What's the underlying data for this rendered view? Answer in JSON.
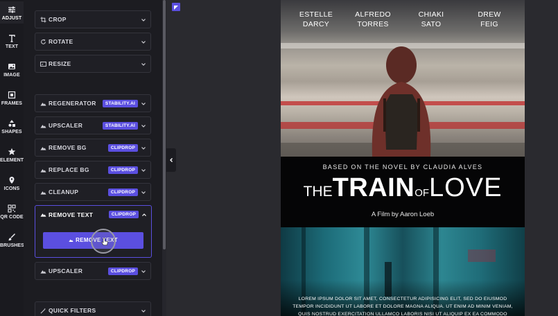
{
  "rail": {
    "items": [
      {
        "label": "ADJUST",
        "icon": "sliders-icon"
      },
      {
        "label": "TEXT",
        "icon": "text-icon"
      },
      {
        "label": "IMAGE",
        "icon": "image-icon"
      },
      {
        "label": "FRAMES",
        "icon": "frames-icon"
      },
      {
        "label": "SHAPES",
        "icon": "shapes-icon"
      },
      {
        "label": "ELEMENTS",
        "icon": "star-icon"
      },
      {
        "label": "ICONS",
        "icon": "pin-icon"
      },
      {
        "label": "QR CODE",
        "icon": "qr-icon"
      },
      {
        "label": "BRUSHES",
        "icon": "brush-icon"
      }
    ]
  },
  "panel": {
    "tools": [
      {
        "label": "CROP",
        "icon": "crop-icon"
      },
      {
        "label": "ROTATE",
        "icon": "rotate-icon"
      },
      {
        "label": "RESIZE",
        "icon": "resize-icon"
      }
    ],
    "ai_tools": [
      {
        "label": "REGENERATOR",
        "badge": "STABILITY.AI"
      },
      {
        "label": "UPSCALER",
        "badge": "STABILITY.AI"
      },
      {
        "label": "REMOVE BG",
        "badge": "CLIPDROP"
      },
      {
        "label": "REPLACE BG",
        "badge": "CLIPDROP"
      },
      {
        "label": "CLEANUP",
        "badge": "CLIPDROP"
      }
    ],
    "expanded": {
      "label": "REMOVE TEXT",
      "badge": "CLIPDROP",
      "button": "REMOVE TEXT"
    },
    "after": [
      {
        "label": "UPSCALER",
        "badge": "CLIPDROP"
      }
    ],
    "quick_filters": {
      "label": "QUICK FILTERS"
    }
  },
  "poster": {
    "names": [
      "ESTELLE",
      "DARCY",
      "ALFREDO",
      "TORRES",
      "CHIAKI",
      "SATO",
      "DREW",
      "FEIG"
    ],
    "subtitle": "BASED ON THE NOVEL BY CLAUDIA ALVES",
    "title": {
      "the": "THE",
      "train": "TRAIN",
      "of": "OF",
      "love": "LOVE"
    },
    "credit": "A Film by Aaron Loeb",
    "lorem": "LOREM IPSUM DOLOR SIT AMET, CONSECTETUR ADIPISICING ELIT, SED DO EIUSMOD TEMPOR INCIDIDUNT UT LABORE ET DOLORE MAGNA ALIQUA. UT ENIM AD MINIM VENIAM, QUIS NOSTRUD EXERCITATION ULLAMCO LABORIS NISI UT ALIQUIP EX EA COMMODO CONSEQUAT"
  },
  "colors": {
    "accent": "#5b4fe0",
    "panel": "#1c1c21",
    "canvas": "#2a2a2f"
  }
}
